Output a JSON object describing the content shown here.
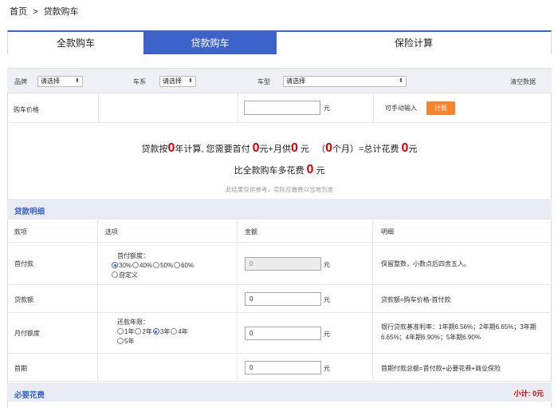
{
  "breadcrumb": {
    "home": "首页",
    "sep": ">",
    "current": "贷款购车"
  },
  "tabs": [
    "全款购车",
    "贷款购车",
    "保险计算"
  ],
  "filter": {
    "brand_label": "品牌",
    "brand_value": "请选择",
    "series_label": "车系",
    "series_value": "请选择",
    "model_label": "车型",
    "model_value": "请选择",
    "clear": "清空数据",
    "arrow": "⬍"
  },
  "price": {
    "label": "购车价格",
    "value": "",
    "unit": "元",
    "manual": "可手动输入",
    "calc": "计算"
  },
  "summary": {
    "p1": "贷款按",
    "years": "0",
    "p2": "年计算, 您需要首付",
    "down": "0",
    "p3": "元+月供",
    "monthly": "0",
    "p4": "元",
    "p5": "（",
    "months": "0",
    "p6": "个月）=总计花费",
    "total": "0",
    "p7": "元",
    "q1": "比全款购车多花费",
    "extra": "0",
    "q2": "元",
    "note": "此结果仅供参考，实际应缴费以当地为准"
  },
  "loan_section": {
    "title": "贷款明细"
  },
  "table": {
    "headers": [
      "款项",
      "选项",
      "金额",
      "明细"
    ],
    "rows": [
      {
        "label": "首付款",
        "group_title": "首付额度：",
        "options": [
          "30%",
          "40%",
          "50%",
          "60%",
          "自定义"
        ],
        "selected": 0,
        "amount": "0",
        "unit": "元",
        "detail": "保留整数，小数点后四舍五入。"
      },
      {
        "label": "贷款额",
        "amount": "0",
        "unit": "元",
        "detail": "贷款额=购车价格-首付款"
      },
      {
        "label": "月付额度",
        "group_title": "还款年限：",
        "options": [
          "1年",
          "2年",
          "3年",
          "4年",
          "5年"
        ],
        "selected": 2,
        "amount": "0",
        "unit": "元",
        "detail": "银行贷款基准利率：1年期6.56%；2年期6.65%；3年期6.65%；4年期6.90%；5年期6.90%"
      },
      {
        "label": "首期",
        "amount": "0",
        "unit": "元",
        "detail": "首期付款总额=首付款+必要花费+商业保险"
      }
    ]
  },
  "necessary_section": {
    "title": "必要花费",
    "subtotal_label": "小计:",
    "subtotal_value": "0元"
  }
}
